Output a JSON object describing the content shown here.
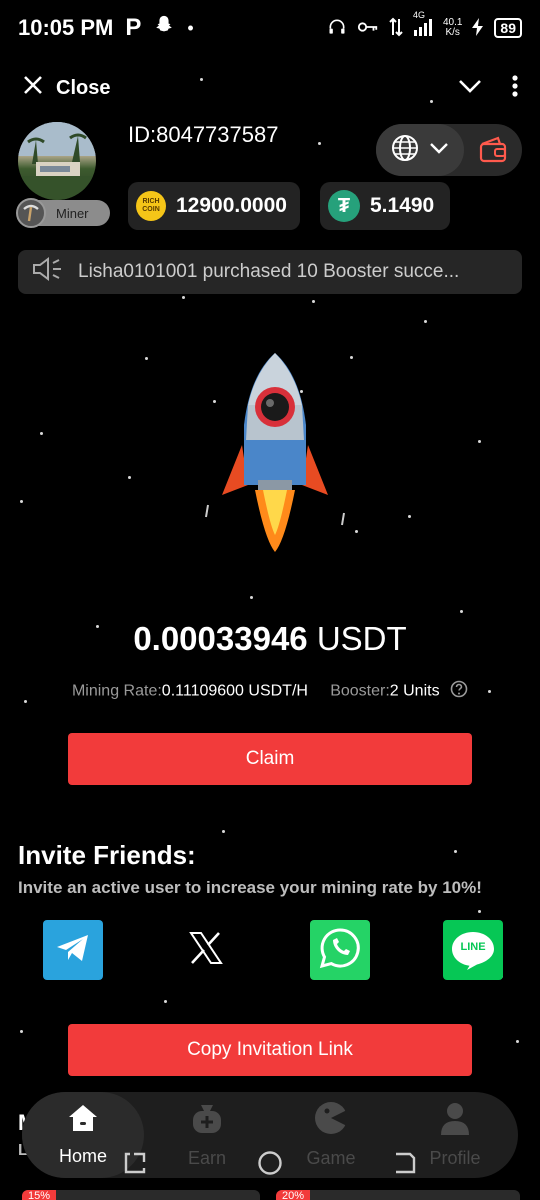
{
  "status_bar": {
    "time": "10:05 PM",
    "app_letter": "P",
    "network_type": "4G",
    "speed_value": "40.1",
    "speed_unit": "K/s",
    "battery": "89"
  },
  "topbar": {
    "close_label": "Close"
  },
  "profile": {
    "user_id": "ID:8047737587",
    "badge": "Miner"
  },
  "balances": {
    "rich_coin_label": "RICH COIN",
    "rich_coin": "12900.0000",
    "usdt": "5.1490"
  },
  "marquee": {
    "text": "Lisha0101001 purchased 10 Booster succe..."
  },
  "mining": {
    "amount": "0.00033946",
    "unit": "USDT",
    "rate_label": "Mining Rate:",
    "rate_value": "0.11109600 USDT/H",
    "booster_label": "Booster:",
    "booster_value": "2 Units"
  },
  "claim_label": "Claim",
  "invite": {
    "title": "Invite Friends:",
    "subtitle": "Invite an active user to increase your mining rate by 10%!",
    "copy_label": "Copy Invitation Link",
    "apps": [
      {
        "name": "telegram",
        "color": "#2aa3dd"
      },
      {
        "name": "x",
        "color": "#000000"
      },
      {
        "name": "whatsapp",
        "color": "#25d366"
      },
      {
        "name": "line",
        "color": "#06c755",
        "label": "LINE"
      }
    ]
  },
  "nav": {
    "items": [
      {
        "label": "Home",
        "icon": "home-icon",
        "active": true
      },
      {
        "label": "Earn",
        "icon": "money-bag-icon"
      },
      {
        "label": "Game",
        "icon": "gamepad-icon"
      },
      {
        "label": "Profile",
        "icon": "person-icon"
      }
    ]
  },
  "peek": {
    "left_tag": "15%",
    "right_tag": "20%"
  },
  "colors": {
    "accent_red": "#f23b3b",
    "usdt_green": "#26a17b",
    "coin_gold": "#f5c518"
  }
}
